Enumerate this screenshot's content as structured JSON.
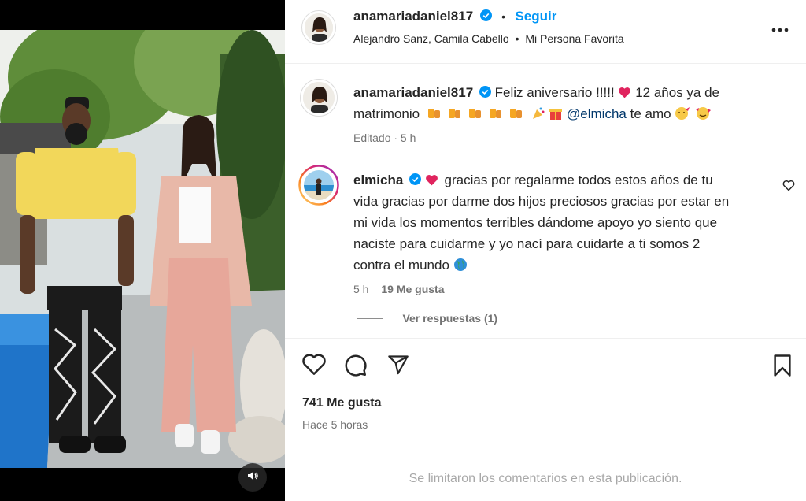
{
  "post": {
    "username": "anamariadaniel817",
    "dot": "•",
    "follow_label": "Seguir",
    "audio_artists": "Alejandro Sanz, Camila Cabello",
    "audio_sep": "•",
    "audio_song": "Mi Persona Favorita",
    "more_icon": "more-horizontal-icon"
  },
  "caption": {
    "username": "anamariadaniel817",
    "text_part1": "Feliz aniversario !!!!!",
    "text_part2": "12 años ya de",
    "text_part3": "matrimonio",
    "mention": "@elmicha",
    "text_part4": "te amo",
    "meta": "Editado · 5 h"
  },
  "comment": {
    "username": "elmicha",
    "line1": "gracias por regalarme todos estos años de tu",
    "line2": "vida gracias por darme dos hijos preciosos gracias por estar en",
    "line3": "mi vida los momentos terribles dándome apoyo yo siento que",
    "line4": "naciste para cuidarme y yo nací para cuidarte a ti somos 2",
    "line5": "contra el mundo",
    "time": "5 h",
    "likes": "19 Me gusta",
    "view_replies": "Ver respuestas (1)"
  },
  "actions": {
    "like_icon": "heart-icon",
    "comment_icon": "comment-icon",
    "share_icon": "share-icon",
    "save_icon": "bookmark-icon"
  },
  "stats": {
    "likes": "741 Me gusta",
    "posted": "Hace 5 horas"
  },
  "footer": {
    "limited_text": "Se limitaron los comentarios en esta publicación."
  },
  "colors": {
    "accent": "#0095f6",
    "verified": "#0095f6",
    "mention": "#00376b",
    "heart": "#ed4956"
  }
}
